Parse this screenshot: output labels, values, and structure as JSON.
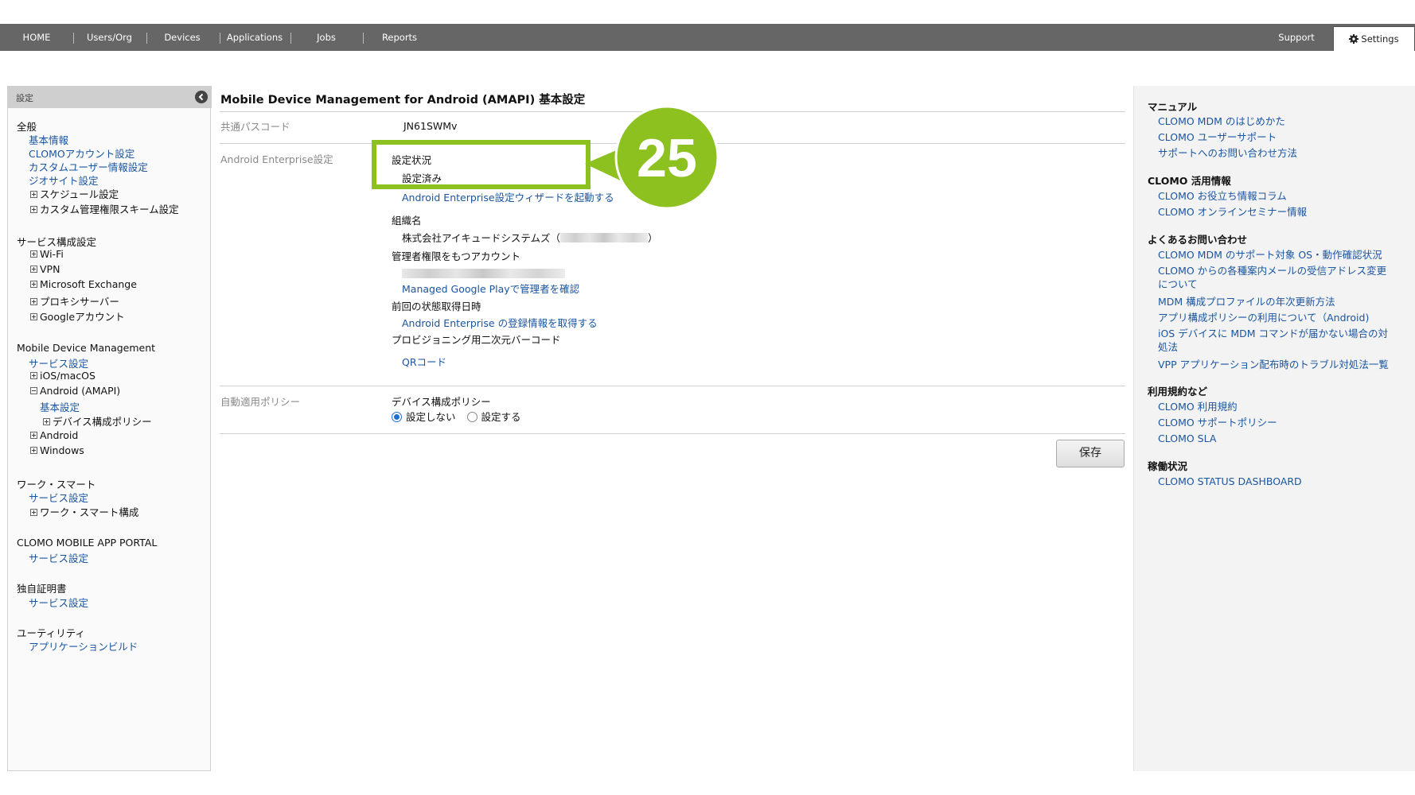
{
  "nav": {
    "items": [
      "HOME",
      "Users/Org",
      "Devices",
      "Applications",
      "Jobs",
      "Reports"
    ],
    "support": "Support",
    "settings": "Settings"
  },
  "sidebar": {
    "header": "設定",
    "general": {
      "title": "全般",
      "basic_info": "基本情報",
      "account": "CLOMOアカウント設定",
      "custom_user": "カスタムユーザー情報設定",
      "geosite": "ジオサイト設定",
      "schedule": "スケジュール設定",
      "custom_admin": "カスタム管理権限スキーム設定"
    },
    "service": {
      "title": "サービス構成設定",
      "wifi": "Wi-Fi",
      "vpn": "VPN",
      "exchange": "Microsoft Exchange",
      "proxy": "プロキシサーバー",
      "google": "Googleアカウント"
    },
    "mdm": {
      "title": "Mobile Device Management",
      "service_setting": "サービス設定",
      "ios": "iOS/macOS",
      "android_amapi": "Android (AMAPI)",
      "basic": "基本設定",
      "device_policy": "デバイス構成ポリシー",
      "android": "Android",
      "windows": "Windows"
    },
    "worksmart": {
      "title": "ワーク・スマート",
      "service_setting": "サービス設定",
      "config": "ワーク・スマート構成"
    },
    "portal": {
      "title": "CLOMO MOBILE APP PORTAL",
      "service_setting": "サービス設定"
    },
    "cert": {
      "title": "独自証明書",
      "service_setting": "サービス設定"
    },
    "utility": {
      "title": "ユーティリティ",
      "app_build": "アプリケーションビルド"
    }
  },
  "main": {
    "title": "Mobile Device Management for Android (AMAPI) 基本設定",
    "passcode_label": "共通パスコード",
    "passcode_value": "JN61SWMv",
    "ae_label": "Android Enterprise設定",
    "status_label": "設定状況",
    "status_value": "設定済み",
    "wizard_link": "Android Enterprise設定ウィザードを起動する",
    "org_label": "組織名",
    "org_value": "株式会社アイキュードシステムズ（",
    "org_close": "）",
    "admin_label": "管理者権限をもつアカウント",
    "managed_play_link": "Managed Google Playで管理者を確認",
    "last_fetch_label": "前回の状態取得日時",
    "fetch_link": "Android Enterprise の登録情報を取得する",
    "barcode_label": "プロビジョニング用二次元バーコード",
    "qr_link": "QRコード",
    "auto_policy_label": "自動適用ポリシー",
    "device_policy_label": "デバイス構成ポリシー",
    "radio_off": "設定しない",
    "radio_on": "設定する",
    "radio_selected": "設定しない",
    "save": "保存",
    "callout_number": "25",
    "callout_color": "#8cc11f"
  },
  "right": {
    "manual": {
      "title": "マニュアル",
      "links": [
        "CLOMO MDM のはじめかた",
        "CLOMO ユーザーサポート",
        "サポートへのお問い合わせ方法"
      ]
    },
    "info": {
      "title": "CLOMO 活用情報",
      "links": [
        "CLOMO お役立ち情報コラム",
        "CLOMO オンラインセミナー情報"
      ]
    },
    "faq": {
      "title": "よくあるお問い合わせ",
      "links": [
        "CLOMO MDM のサポート対象 OS・動作確認状況",
        "CLOMO からの各種案内メールの受信アドレス変更",
        "について",
        "MDM 構成プロファイルの年次更新方法",
        "アプリ構成ポリシーの利用について（Android)",
        "iOS デバイスに MDM コマンドが届かない場合の対",
        "処法",
        "VPP アプリケーション配布時のトラブル対処法一覧"
      ]
    },
    "terms": {
      "title": "利用規約など",
      "links": [
        "CLOMO 利用規約",
        "CLOMO サポートポリシー",
        "CLOMO SLA"
      ]
    },
    "status": {
      "title": "稼働状況",
      "links": [
        "CLOMO STATUS DASHBOARD"
      ]
    }
  }
}
